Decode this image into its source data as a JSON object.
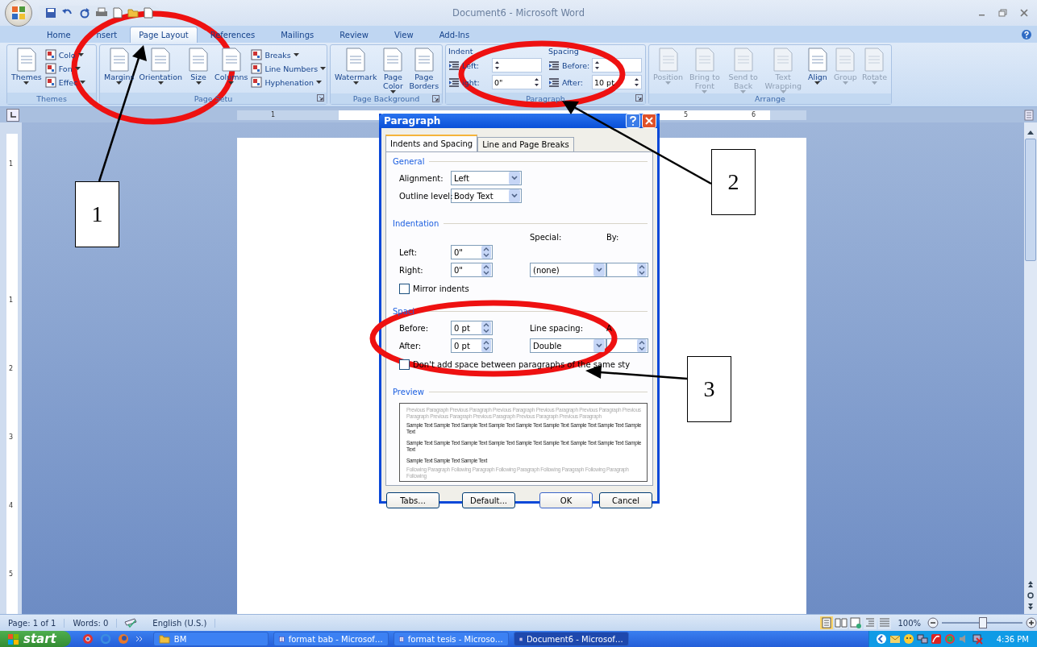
{
  "window": {
    "title": "Document6 - Microsoft Word"
  },
  "tabs": [
    {
      "label": "Home",
      "selected": false
    },
    {
      "label": "nsert",
      "selected": false
    },
    {
      "label": "Page Layout",
      "selected": true
    },
    {
      "label": "References",
      "selected": false
    },
    {
      "label": "Mailings",
      "selected": false
    },
    {
      "label": "Review",
      "selected": false
    },
    {
      "label": "View",
      "selected": false
    },
    {
      "label": "Add-Ins",
      "selected": false
    }
  ],
  "ribbon": {
    "groups": [
      {
        "label": "Themes",
        "large": [
          {
            "label": "Themes",
            "dropdown": true,
            "disabled": false
          }
        ],
        "small": [
          {
            "label": "Colo",
            "dropdown": true
          },
          {
            "label": "Fon",
            "dropdown": true
          },
          {
            "label": "Effec",
            "dropdown": true
          }
        ]
      },
      {
        "label": "Page Setu",
        "large": [
          {
            "label": "Margins",
            "dropdown": true,
            "disabled": false
          },
          {
            "label": "Orientation",
            "dropdown": true,
            "disabled": false
          },
          {
            "label": "Size",
            "dropdown": true,
            "disabled": false
          },
          {
            "label": "Columns",
            "dropdown": true,
            "disabled": false
          }
        ],
        "small": [
          {
            "label": "Breaks",
            "dropdown": true
          },
          {
            "label": "Line Numbers",
            "dropdown": true
          },
          {
            "label": "Hyphenation",
            "dropdown": true
          }
        ]
      },
      {
        "label": "Page Background",
        "large": [
          {
            "label": "Watermark",
            "dropdown": true,
            "disabled": false
          },
          {
            "label": "Page Color",
            "dropdown": true,
            "disabled": false
          },
          {
            "label": "Page Borders",
            "dropdown": false,
            "disabled": false
          }
        ]
      },
      {
        "label": "Paragraph",
        "columns": [
          {
            "heading": "Indent",
            "spins": [
              {
                "label": "Left:"
              },
              {
                "label": "ight:",
                "value": "0\""
              }
            ]
          },
          {
            "heading": "Spacing",
            "spins": [
              {
                "label": "Before:"
              },
              {
                "label": "After:",
                "value": "10 pt"
              }
            ]
          }
        ]
      },
      {
        "label": "Arrange",
        "large": [
          {
            "label": "Position",
            "dropdown": true,
            "disabled": true
          },
          {
            "label": "Bring to Front",
            "dropdown": true,
            "disabled": true
          },
          {
            "label": "Send to Back",
            "dropdown": true,
            "disabled": true
          },
          {
            "label": "Text Wrapping",
            "dropdown": true,
            "disabled": true
          },
          {
            "label": "Align",
            "dropdown": true,
            "disabled": false
          },
          {
            "label": "Group",
            "dropdown": true,
            "disabled": true
          },
          {
            "label": "Rotate",
            "dropdown": true,
            "disabled": true
          }
        ]
      }
    ]
  },
  "ruler": {
    "labels": [
      "1",
      "5",
      "6"
    ]
  },
  "vertical_ruler": {
    "labels": [
      "1",
      "1",
      "2",
      "3",
      "4",
      "5"
    ]
  },
  "dialog": {
    "title": "Paragraph",
    "tabs": [
      {
        "label": "Indents and Spacing",
        "selected": true
      },
      {
        "label": "Line and Page Breaks",
        "selected": false
      }
    ],
    "general": {
      "heading": "General",
      "fields": [
        {
          "label": "Alignment:",
          "value": "Left"
        },
        {
          "label": "Outline level:",
          "value": "Body Text"
        }
      ]
    },
    "indentation": {
      "heading": "Indentation",
      "left": {
        "label": "Left:",
        "value": "0\""
      },
      "right": {
        "label": "Right:",
        "value": "0\""
      },
      "special": {
        "label": "Special:",
        "value": "(none)"
      },
      "by": {
        "label": "By:"
      },
      "mirror": {
        "label": "Mirror indents",
        "checked": false
      }
    },
    "spacing": {
      "heading": "Spaci",
      "before": {
        "label": "Before:",
        "value": "0 pt"
      },
      "after": {
        "label": "After:",
        "value": "0 pt"
      },
      "line_spacing": {
        "label": "Line spacing:",
        "value": "Double"
      },
      "at": {
        "label": "A"
      },
      "no_space": {
        "label": "Don't add space between paragraphs of the same sty",
        "checked": false
      }
    },
    "preview": {
      "heading": "Preview",
      "previous": [
        "Previous Paragraph Previous Paragraph Previous Paragraph Previous Paragraph Previous Paragraph Previous",
        "Paragraph Previous Paragraph Previous Paragraph Previous Paragraph Previous Paragraph"
      ],
      "sample": [
        "Sample Text Sample Text Sample Text Sample Text Sample Text Sample Text Sample Text Sample Text Sample Text",
        "Sample Text Sample Text Sample Text Sample Text Sample Text Sample Text Sample Text Sample Text Sample Text",
        "Sample Text Sample Text Sample Text"
      ],
      "following": [
        "Following Paragraph Following Paragraph Following Paragraph Following Paragraph Following Paragraph Following"
      ]
    },
    "buttons": [
      {
        "label": "Tabs..."
      },
      {
        "label": "Default..."
      },
      {
        "label": "OK"
      },
      {
        "label": "Cancel"
      }
    ]
  },
  "annotations": [
    {
      "label": "1"
    },
    {
      "label": "2"
    },
    {
      "label": "3"
    }
  ],
  "status_bar": {
    "page": "Page: 1 of 1",
    "words": "Words: 0",
    "language": "English (U.S.)",
    "zoom": "100%",
    "zoom_slider": {
      "level": 0.5
    }
  },
  "taskbar": {
    "start": "start",
    "items": [
      {
        "label": "BM",
        "kind": "folder",
        "selected": false
      },
      {
        "label": "format bab - Microsof…",
        "kind": "document",
        "selected": false
      },
      {
        "label": "format tesis - Microso…",
        "kind": "document",
        "selected": false
      },
      {
        "label": "Document6 - Microsof…",
        "kind": "document",
        "selected": true
      }
    ],
    "clock": "4:36 PM"
  }
}
